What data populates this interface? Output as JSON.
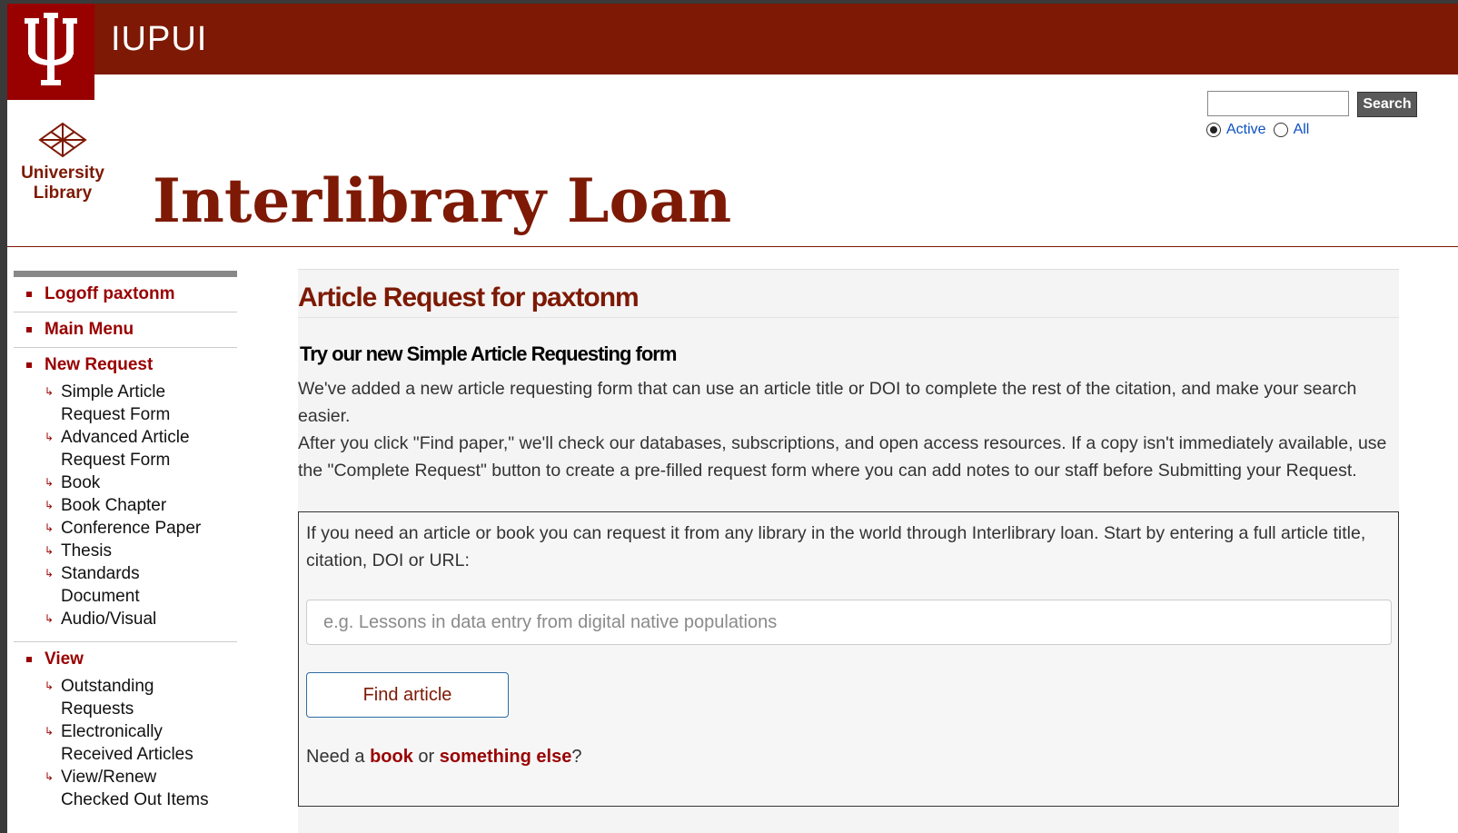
{
  "header": {
    "campus": "IUPUI",
    "logo_text": "University Library",
    "title": "Interlibrary Loan",
    "search": {
      "value": "",
      "button_label": "Search"
    },
    "scope": [
      {
        "label": "Active",
        "checked": true
      },
      {
        "label": "All",
        "checked": false
      }
    ]
  },
  "sidebar": {
    "logoff": "Logoff paxtonm",
    "main_menu": "Main Menu",
    "new_request": {
      "label": "New Request",
      "items": [
        "Simple Article Request Form",
        "Advanced Article Request Form",
        "Book",
        "Book Chapter",
        "Conference Paper",
        "Thesis",
        "Standards Document",
        "Audio/Visual"
      ]
    },
    "view": {
      "label": "View",
      "items": [
        "Outstanding Requests",
        "Electronically Received Articles",
        "View/Renew Checked Out Items"
      ]
    }
  },
  "main": {
    "title": "Article Request for paxtonm",
    "promo_heading": "Try our new Simple Article Requesting form",
    "para1": "We've added a new article requesting form that can use an article title or DOI to complete the rest of the citation, and make your search easier.",
    "para2": "After you click \"Find paper,\" we'll check our databases, subscriptions, and open access resources. If a copy isn't immediately available, use the \"Complete Request\" button to create a pre-filled request form where you can add notes to our staff before Submitting your Request.",
    "box_intro": "If you need an article or book you can request it from any library in the world through Interlibrary loan. Start by entering a full article title, citation, DOI or URL:",
    "input_placeholder": "e.g. Lessons in data entry from digital native populations",
    "find_button": "Find article",
    "alt": {
      "prefix": "Need a ",
      "book": "book",
      "or": " or ",
      "else": "something else",
      "suffix": "?"
    }
  },
  "colors": {
    "crimson": "#7d1904",
    "iu_red": "#990000",
    "link_blue": "#0b4fc2"
  }
}
